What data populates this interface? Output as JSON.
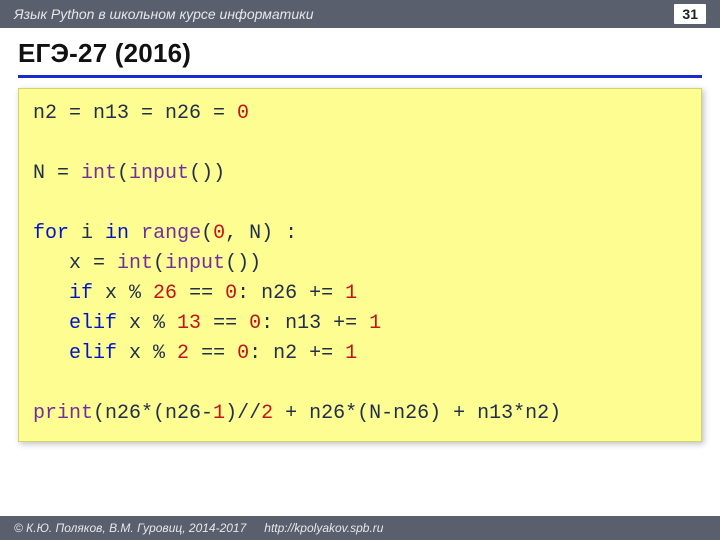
{
  "header": {
    "course": "Язык Python в школьном курсе информатики",
    "page": "31"
  },
  "title": "ЕГЭ-27 (2016)",
  "code": {
    "l1": {
      "a": "n2 = n13 = n26 = ",
      "n0": "0"
    },
    "l2": "",
    "l3": {
      "a": "N = ",
      "int": "int",
      "p1": "(",
      "inp": "input",
      "p2": "())"
    },
    "l4": "",
    "l5": {
      "for": "for",
      "a": " i ",
      "in": "in",
      "sp": " ",
      "rng": "range",
      "p1": "(",
      "n0": "0",
      "c": ", N) :"
    },
    "l6": {
      "pad": "   x = ",
      "int": "int",
      "p1": "(",
      "inp": "input",
      "p2": "())"
    },
    "l7": {
      "pad": "   ",
      "if": "if",
      "a": " x % ",
      "n26": "26",
      "b": " == ",
      "z": "0",
      "c": ": n26 += ",
      "one": "1"
    },
    "l8": {
      "pad": "   ",
      "elif": "elif",
      "a": " x % ",
      "n13": "13",
      "b": " == ",
      "z": "0",
      "c": ": n13 += ",
      "one": "1"
    },
    "l9": {
      "pad": "   ",
      "elif": "elif",
      "a": " x % ",
      "n2": "2",
      "b": " == ",
      "z": "0",
      "c": ": n2 += ",
      "one": "1"
    },
    "l10": "",
    "l11": {
      "print": "print",
      "a": "(n26*(n26-",
      "one1": "1",
      "b": ")//",
      "two": "2",
      "c": " + n26*(N-n26) + n13*n2)"
    }
  },
  "footer": {
    "copyright": "© К.Ю. Поляков, В.М. Гуровиц, 2014-2017",
    "url": "http://kpolyakov.spb.ru"
  }
}
